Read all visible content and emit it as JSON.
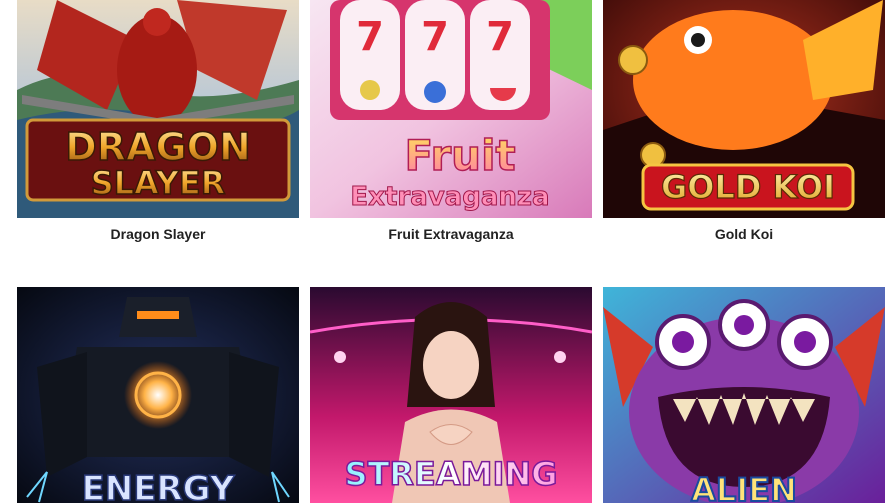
{
  "games": [
    {
      "title": "Dragon Slayer",
      "logo_line1": "DRAGON",
      "logo_line2": "SLAYER"
    },
    {
      "title": "Fruit Extravaganza",
      "logo_line1": "Fruit",
      "logo_line2": "Extravaganza"
    },
    {
      "title": "Gold Koi",
      "logo_line1": "GOLD KOI"
    },
    {
      "title": "",
      "logo_line1": "ENERGY"
    },
    {
      "title": "",
      "logo_line1": "STREAMING"
    },
    {
      "title": "",
      "logo_line1": "ALIEN"
    }
  ],
  "colors": {
    "caption_text": "#222222",
    "background": "#ffffff"
  }
}
